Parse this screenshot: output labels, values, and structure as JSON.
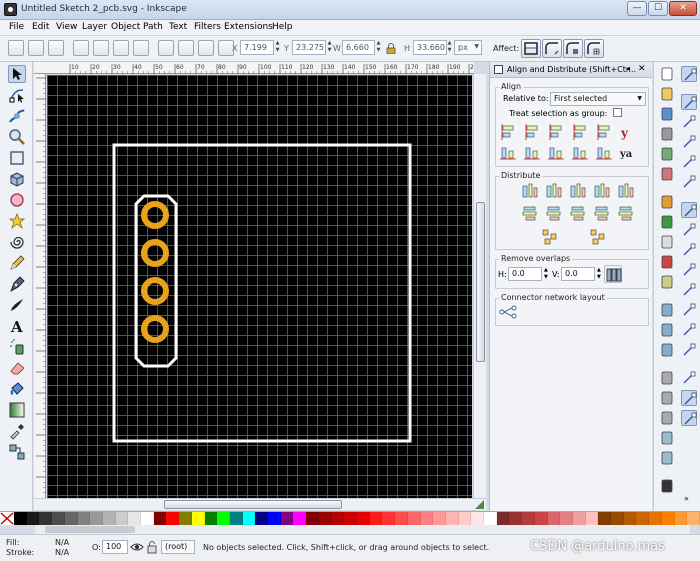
{
  "window": {
    "title": "Untitled Sketch 2_pcb.svg - Inkscape",
    "minimize": "—",
    "maximize": "☐",
    "close": "✕"
  },
  "menu": [
    "File",
    "Edit",
    "View",
    "Layer",
    "Object",
    "Path",
    "Text",
    "Filters",
    "Extensions",
    "Help"
  ],
  "toolbar": {
    "x_label": "X",
    "x_value": "7.199",
    "y_label": "Y",
    "y_value": "23.275",
    "w_label": "W",
    "w_value": "6.660",
    "h_label": "H",
    "h_value": "33.660",
    "unit": "px",
    "affect_label": "Affect:"
  },
  "tools": [
    "selector-tool",
    "node-tool",
    "tweak-tool",
    "zoom-tool",
    "rectangle-tool",
    "3d-box-tool",
    "ellipse-tool",
    "star-tool",
    "spiral-tool",
    "pencil-tool",
    "pen-tool",
    "calligraphy-tool",
    "text-tool",
    "spray-tool",
    "eraser-tool",
    "paint-bucket-tool",
    "gradient-tool",
    "dropper-tool",
    "connector-tool"
  ],
  "ruler": {
    "labels": [
      "10",
      "20",
      "30",
      "40",
      "50",
      "60",
      "70",
      "80",
      "90",
      "100",
      "110",
      "120",
      "130",
      "140",
      "150",
      "160",
      "170",
      "180",
      "190",
      "200"
    ]
  },
  "panel": {
    "title": "Align and Distribute (Shift+Ctr...",
    "align_title": "Align",
    "relative_to_label": "Relative to:",
    "relative_to_value": "First selected",
    "treat_group_label": "Treat selection as group:",
    "distribute_title": "Distribute",
    "remove_overlaps_title": "Remove overlaps",
    "h_label": "H:",
    "h_value": "0.0",
    "v_label": "V:",
    "v_value": "0.0",
    "connector_title": "Connector network layout"
  },
  "status": {
    "fill_label": "Fill:",
    "fill_value": "N/A",
    "stroke_label": "Stroke:",
    "stroke_value": "N/A",
    "opacity_label": "O:",
    "opacity_value": "100",
    "layer_value": "(root)",
    "message": "No objects selected. Click, Shift+click, or drag around objects to select.",
    "watermark": "CSDN @arduino.mas"
  },
  "colors": {
    "canvas": "#000000",
    "pad_ring": "#e8a31a",
    "board_outline": "#ffffff",
    "accent": "#7d98c0"
  },
  "palette": [
    "#000000",
    "#1a1a1a",
    "#333333",
    "#4d4d4d",
    "#666666",
    "#808080",
    "#999999",
    "#b3b3b3",
    "#cccccc",
    "#e6e6e6",
    "#ffffff",
    "#800000",
    "#ff0000",
    "#808000",
    "#ffff00",
    "#008000",
    "#00ff00",
    "#008080",
    "#00ffff",
    "#000080",
    "#0000ff",
    "#800080",
    "#ff00ff",
    "#7f0000",
    "#990000",
    "#b30000",
    "#cc0000",
    "#e60000",
    "#ff1a1a",
    "#ff3333",
    "#ff4d4d",
    "#ff6666",
    "#ff8080",
    "#ff9999",
    "#ffb3b3",
    "#ffcccc",
    "#ffe6e6",
    "#ffffff",
    "#7f2a2a",
    "#993333",
    "#b33c3c",
    "#cc4444",
    "#d9666f",
    "#e68080",
    "#f0a0a0",
    "#ffc0c0",
    "#7f3f00",
    "#994c00",
    "#b35900",
    "#cc6600",
    "#e67300",
    "#ff8000",
    "#ff9933",
    "#ffb366"
  ]
}
